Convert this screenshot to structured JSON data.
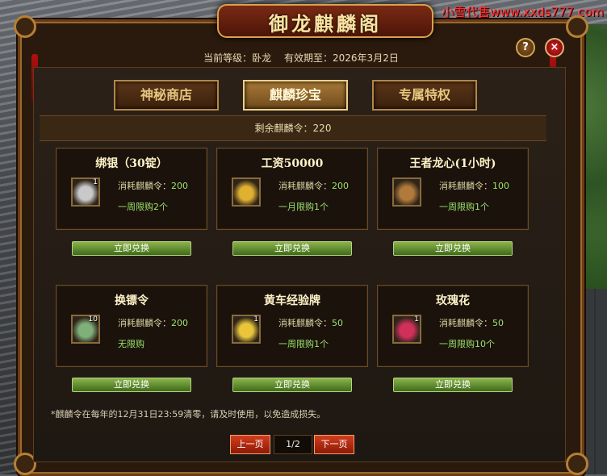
{
  "watermark": "小雪代售www.xxds777.com",
  "window": {
    "title": "御龙麒麟阁",
    "level_label": "当前等级：卧龙",
    "expiry_label": "有效期至：2026年3月2日",
    "help_glyph": "?",
    "close_glyph": "×"
  },
  "tabs": [
    {
      "label": "神秘商店",
      "active": false
    },
    {
      "label": "麒麟珍宝",
      "active": true
    },
    {
      "label": "专属特权",
      "active": false
    }
  ],
  "remaining": "剩余麒麟令：220",
  "cost_prefix": "消耗麒麟令：",
  "items": [
    {
      "title": "绑银（30锭）",
      "icon": "silver-ingot-icon",
      "count": "1",
      "cost": "200",
      "limit": "一周限购2个",
      "button": "立即兑换",
      "icon_color": "#c9c9c9"
    },
    {
      "title": "工资50000",
      "icon": "gold-coins-icon",
      "count": "",
      "cost": "200",
      "limit": "一月限购1个",
      "button": "立即兑换",
      "icon_color": "#e0b030"
    },
    {
      "title": "王者龙心(1小时)",
      "icon": "dragon-heart-icon",
      "count": "",
      "cost": "100",
      "limit": "一周限购1个",
      "button": "立即兑换",
      "icon_color": "#b07a3c"
    },
    {
      "title": "换镖令",
      "icon": "token-icon",
      "count": "10",
      "cost": "200",
      "limit": "无限购",
      "button": "立即兑换",
      "icon_color": "#7fb07a"
    },
    {
      "title": "黄车经验牌",
      "icon": "yellow-cart-icon",
      "count": "1",
      "cost": "50",
      "limit": "一周限购1个",
      "button": "立即兑换",
      "icon_color": "#e8c53a"
    },
    {
      "title": "玫瑰花",
      "icon": "rose-icon",
      "count": "1",
      "cost": "50",
      "limit": "一周限购10个",
      "button": "立即兑换",
      "icon_color": "#d0305a"
    }
  ],
  "notice": "*麒麟令在每年的12月31日23:59清零，请及时使用，以免造成损失。",
  "pager": {
    "prev": "上一页",
    "page": "1/2",
    "next": "下一页"
  },
  "colors": {
    "accent_green": "#9ee36f",
    "frame_gold": "#b48748",
    "watermark_red": "#ff2a2a"
  }
}
